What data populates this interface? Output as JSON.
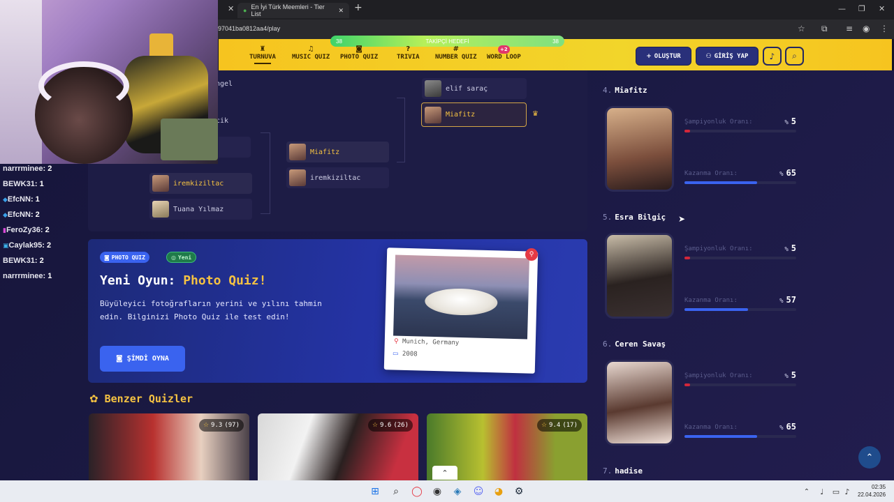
{
  "browser": {
    "tab_title": "En İyi Türk Meemleri - Tier List",
    "url": "97041ba0812aa4/play"
  },
  "header": {
    "follow_goal": "TAKİPÇİ HEDEFİ",
    "follow_left": "38",
    "follow_right": "38",
    "nav": [
      {
        "label": "TURNUVA",
        "icon": "trophy-icon",
        "glyph": "♜"
      },
      {
        "label": "MUSIC QUIZ",
        "icon": "music-icon",
        "glyph": "♫"
      },
      {
        "label": "PHOTO QUIZ",
        "icon": "camera-icon",
        "glyph": "◙"
      },
      {
        "label": "TRIVIA",
        "icon": "question-icon",
        "glyph": "?"
      },
      {
        "label": "NUMBER QUIZ",
        "icon": "hash-icon",
        "glyph": "#"
      },
      {
        "label": "WORD LOOP",
        "icon": "loop-icon",
        "glyph": "↻",
        "badge": "+2"
      }
    ],
    "create_label": "OLUŞTUR",
    "login_label": "GİRİŞ YAP"
  },
  "bracket": {
    "partial_top": "ngel",
    "partial_mid": "cik",
    "round1": [
      {
        "name": "iremkiziltac",
        "winner": true
      },
      {
        "name": "Tuana Yılmaz",
        "winner": false
      }
    ],
    "round2": [
      {
        "name": "Miafitz",
        "winner": true
      },
      {
        "name": "iremkiziltac",
        "winner": false
      }
    ],
    "final": [
      {
        "name": "elif saraç",
        "winner": false
      },
      {
        "name": "Miafitz",
        "winner": true
      }
    ]
  },
  "promo": {
    "tag": "PHOTO QUIZ",
    "new_tag": "Yeni",
    "title_prefix": "Yeni Oyun:",
    "title_highlight": "Photo Quiz!",
    "description": "Büyüleyici fotoğrafların yerini ve yılını tahmin edin. Bilginizi Photo Quiz ile test edin!",
    "play_label": "ŞİMDİ OYNA",
    "photo_location": "Munich, Germany",
    "photo_year": "2008"
  },
  "similar": {
    "title": "Benzer Quizler",
    "cards": [
      {
        "rating": "9.3",
        "count": "(97)"
      },
      {
        "rating": "9.6",
        "count": "(26)"
      },
      {
        "rating": "9.4",
        "count": "(17)"
      }
    ]
  },
  "ranking": {
    "champ_label": "Şampiyonluk Oranı:",
    "win_label": "Kazanma Oranı:",
    "percent_sign": "%",
    "entries": [
      {
        "rank": "4.",
        "name": "Miafitz",
        "champ": "5",
        "win": "65",
        "champ_fraction": 0.05,
        "win_fraction": 0.65
      },
      {
        "rank": "5.",
        "name": "Esra Bilgiç",
        "champ": "5",
        "win": "57",
        "champ_fraction": 0.05,
        "win_fraction": 0.57
      },
      {
        "rank": "6.",
        "name": "Ceren Savaş",
        "champ": "5",
        "win": "65",
        "champ_fraction": 0.05,
        "win_fraction": 0.65
      },
      {
        "rank": "7.",
        "name": "hadise"
      }
    ]
  },
  "chat": [
    {
      "user": "narrrminee",
      "value": ": 2"
    },
    {
      "user": "BEWK31",
      "value": ": 1"
    },
    {
      "user": "EfcNN",
      "value": ": 1"
    },
    {
      "user": "EfcNN",
      "value": ": 2"
    },
    {
      "user": "FeroZy36",
      "value": ": 2"
    },
    {
      "user": "Caylak95",
      "value": ": 2"
    },
    {
      "user": "BEWK31",
      "value": ": 2"
    },
    {
      "user": "narrrminee",
      "value": ": 1"
    }
  ],
  "taskbar": {
    "time": "02:35",
    "date": "22.04.2026"
  },
  "colors": {
    "accent_yellow": "#f5c242",
    "header_yellow": "#f6c41f",
    "promo_blue": "#2433a4",
    "bar_red": "#d3263a",
    "bar_blue": "#3a63ef"
  }
}
